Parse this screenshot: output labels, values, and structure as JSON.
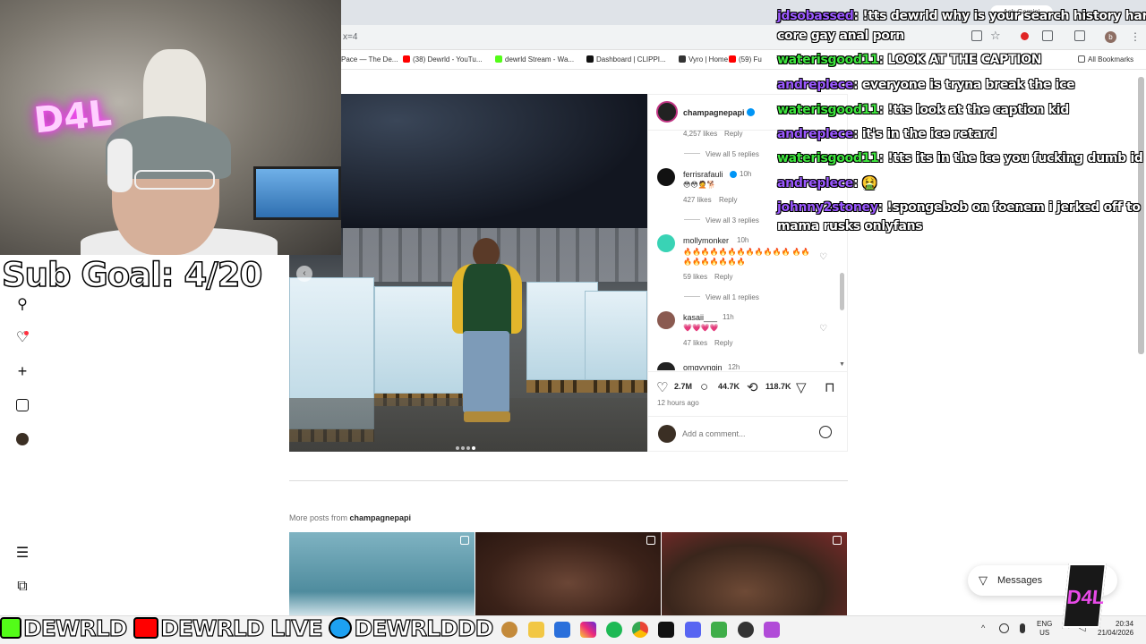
{
  "browser": {
    "address_fragment": "x=4",
    "ask_gemini": "Ask Gemini",
    "profile_initial": "b",
    "bookmarks": [
      {
        "label": "Pace — The De...",
        "color": "#cfcfcf"
      },
      {
        "label": "(38) Dewrld - YouTu...",
        "color": "#ff0000"
      },
      {
        "label": "dewrld Stream - Wa...",
        "color": "#53fc18"
      },
      {
        "label": "Dashboard | CLIPPI...",
        "color": "#111111"
      },
      {
        "label": "Vyro | Home",
        "color": "#333333"
      },
      {
        "label": "(59) Fu",
        "color": "#ff0000"
      }
    ],
    "all_bookmarks": "All Bookmarks"
  },
  "stream_overlay": {
    "sub_goal": "Sub Goal: 4/20",
    "socials": [
      {
        "label": "DEWRLD",
        "icon": "kick-icon",
        "color": "#53fc18"
      },
      {
        "label": "DEWRLD LIVE",
        "icon": "youtube-icon",
        "color": "#ff0000"
      },
      {
        "label": "DEWRLDDD",
        "icon": "twitter-icon",
        "color": "#1da1f2"
      }
    ],
    "chat": [
      {
        "user": "jdsobassed",
        "message": "!tts dewrld why is your search history hard",
        "user_color": "#9b59ff"
      },
      {
        "user": "",
        "message": "core gay anal porn",
        "user_color": "#ffffff"
      },
      {
        "user": "waterisgood11",
        "message": "LOOK AT THE CAPTION",
        "user_color": "#3ee63e"
      },
      {
        "user": "andreplece",
        "message": "everyone is tryna break the ice",
        "user_color": "#9b59ff"
      },
      {
        "user": "waterisgood11",
        "message": "!tts look at the caption kid",
        "user_color": "#3ee63e"
      },
      {
        "user": "andreplece",
        "message": "it's in the ice retard",
        "user_color": "#9b59ff"
      },
      {
        "user": "waterisgood11",
        "message": "!tts its in the ice you fucking dumb id",
        "user_color": "#3ee63e"
      },
      {
        "user": "andreplece",
        "message": "🤮",
        "user_color": "#9b59ff"
      },
      {
        "user": "johnny2stoney",
        "message": "!spongebob on foenem i jerked off to",
        "user_color": "#9b59ff"
      },
      {
        "user": "",
        "message": "mama rusks onlyfans",
        "user_color": "#ffffff"
      }
    ],
    "webcam_sign": "D4L"
  },
  "post": {
    "author": "champagnepapi",
    "likes": "2.7M",
    "comments_count": "44.7K",
    "reposts": "118.7K",
    "time_ago": "12 hours ago",
    "add_comment_placeholder": "Add a comment...",
    "comments": [
      {
        "likes_label": "4,257 likes",
        "reply": "Reply",
        "view_replies": "View all 5 replies"
      },
      {
        "user": "ferrisrafauli",
        "verified": true,
        "time": "10h",
        "text": "😳😳🤦🐕",
        "likes_label": "427 likes",
        "reply": "Reply",
        "view_replies": "View all 3 replies"
      },
      {
        "user": "mollymonker",
        "time": "10h",
        "text": "🔥🔥🔥🔥🔥🔥🔥🔥🔥🔥🔥🔥 🔥🔥🔥🔥🔥🔥🔥🔥🔥",
        "likes_label": "59 likes",
        "reply": "Reply",
        "view_replies": "View all 1 replies"
      },
      {
        "user": "kasaii___",
        "time": "11h",
        "text": "💗💗💗💗",
        "likes_label": "47 likes",
        "reply": "Reply"
      },
      {
        "user": "omgyvngin",
        "time": "12h"
      }
    ]
  },
  "more_posts": {
    "prefix": "More posts from ",
    "author": "champagnepapi"
  },
  "messages_button": "Messages",
  "tray": {
    "lang_top": "ENG",
    "lang_bottom": "US",
    "time": "20:34",
    "date": "21/04/2026"
  },
  "colors": {
    "verified": "#0095f6",
    "ig_text": "#262626",
    "muted": "#737373"
  }
}
